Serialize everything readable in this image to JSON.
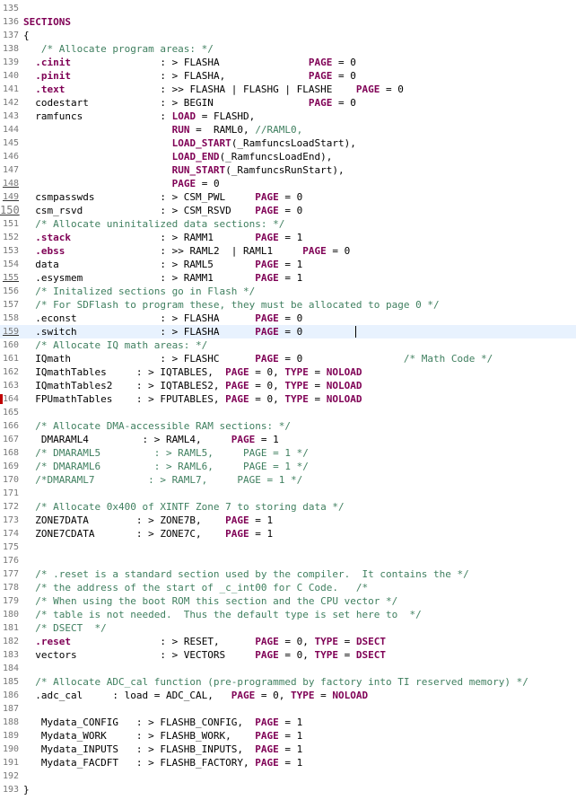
{
  "editor": {
    "current_line": 159,
    "caret_line": 159,
    "lines": [
      {
        "n": "135",
        "code": []
      },
      {
        "n": "136",
        "code": [
          {
            "t": "SECTIONS",
            "c": "kw"
          }
        ]
      },
      {
        "n": "137",
        "code": [
          {
            "t": "{",
            "c": ""
          }
        ]
      },
      {
        "n": "138",
        "code": [
          {
            "t": "   /* Allocate program areas: */",
            "c": "cm"
          }
        ]
      },
      {
        "n": "139",
        "code": [
          {
            "t": "  ",
            "c": ""
          },
          {
            "t": ".cinit",
            "c": "sec"
          },
          {
            "t": "               : > FLASHA               ",
            "c": ""
          },
          {
            "t": "PAGE",
            "c": "kw"
          },
          {
            "t": " = 0",
            "c": ""
          }
        ]
      },
      {
        "n": "140",
        "code": [
          {
            "t": "  ",
            "c": ""
          },
          {
            "t": ".pinit",
            "c": "sec"
          },
          {
            "t": "               : > FLASHA,              ",
            "c": ""
          },
          {
            "t": "PAGE",
            "c": "kw"
          },
          {
            "t": " = 0",
            "c": ""
          }
        ]
      },
      {
        "n": "141",
        "code": [
          {
            "t": "  ",
            "c": ""
          },
          {
            "t": ".text",
            "c": "sec"
          },
          {
            "t": "                : >> FLASHA | FLASHG | FLASHE    ",
            "c": ""
          },
          {
            "t": "PAGE",
            "c": "kw"
          },
          {
            "t": " = 0",
            "c": ""
          }
        ]
      },
      {
        "n": "142",
        "code": [
          {
            "t": "  codestart            : > BEGIN                ",
            "c": ""
          },
          {
            "t": "PAGE",
            "c": "kw"
          },
          {
            "t": " = 0",
            "c": ""
          }
        ]
      },
      {
        "n": "143",
        "code": [
          {
            "t": "  ramfuncs             : ",
            "c": ""
          },
          {
            "t": "LOAD",
            "c": "kw"
          },
          {
            "t": " = FLASHD,",
            "c": ""
          }
        ]
      },
      {
        "n": "144",
        "code": [
          {
            "t": "                         ",
            "c": ""
          },
          {
            "t": "RUN",
            "c": "kw"
          },
          {
            "t": " =  RAML0, ",
            "c": ""
          },
          {
            "t": "//RAML0,",
            "c": "cm"
          }
        ]
      },
      {
        "n": "145",
        "code": [
          {
            "t": "                         ",
            "c": ""
          },
          {
            "t": "LOAD_START",
            "c": "kw"
          },
          {
            "t": "(_RamfuncsLoadStart),",
            "c": ""
          }
        ]
      },
      {
        "n": "146",
        "code": [
          {
            "t": "                         ",
            "c": ""
          },
          {
            "t": "LOAD_END",
            "c": "kw"
          },
          {
            "t": "(_RamfuncsLoadEnd),",
            "c": ""
          }
        ]
      },
      {
        "n": "147",
        "code": [
          {
            "t": "                         ",
            "c": ""
          },
          {
            "t": "RUN_START",
            "c": "kw"
          },
          {
            "t": "(_RamfuncsRunStart),",
            "c": ""
          }
        ]
      },
      {
        "n": "148",
        "u": true,
        "code": [
          {
            "t": "                         ",
            "c": ""
          },
          {
            "t": "PAGE",
            "c": "kw"
          },
          {
            "t": " = 0",
            "c": ""
          }
        ]
      },
      {
        "n": "149",
        "u": true,
        "code": [
          {
            "t": "  csmpasswds           : > CSM_PWL     ",
            "c": ""
          },
          {
            "t": "PAGE",
            "c": "kw"
          },
          {
            "t": " = 0",
            "c": ""
          }
        ]
      },
      {
        "n": "150",
        "u": true,
        "big": true,
        "code": [
          {
            "t": "  csm_rsvd             : > CSM_RSVD    ",
            "c": ""
          },
          {
            "t": "PAGE",
            "c": "kw"
          },
          {
            "t": " = 0",
            "c": ""
          }
        ]
      },
      {
        "n": "151",
        "code": [
          {
            "t": "  /* Allocate uninitalized data sections: */",
            "c": "cm"
          }
        ]
      },
      {
        "n": "152",
        "code": [
          {
            "t": "  ",
            "c": ""
          },
          {
            "t": ".stack",
            "c": "sec"
          },
          {
            "t": "               : > RAMM1       ",
            "c": ""
          },
          {
            "t": "PAGE",
            "c": "kw"
          },
          {
            "t": " = 1",
            "c": ""
          }
        ]
      },
      {
        "n": "153",
        "code": [
          {
            "t": "  ",
            "c": ""
          },
          {
            "t": ".ebss",
            "c": "sec"
          },
          {
            "t": "                : >> RAML2  | RAML1     ",
            "c": ""
          },
          {
            "t": "PAGE",
            "c": "kw"
          },
          {
            "t": " = 0",
            "c": ""
          }
        ]
      },
      {
        "n": "154",
        "code": [
          {
            "t": "  data                 : > RAML5       ",
            "c": ""
          },
          {
            "t": "PAGE",
            "c": "kw"
          },
          {
            "t": " = 1",
            "c": ""
          }
        ]
      },
      {
        "n": "155",
        "u": true,
        "code": [
          {
            "t": "  .esysmem             : > RAMM1       ",
            "c": ""
          },
          {
            "t": "PAGE",
            "c": "kw"
          },
          {
            "t": " = 1",
            "c": ""
          }
        ]
      },
      {
        "n": "156",
        "code": [
          {
            "t": "  /* Initalized sections go in Flash */",
            "c": "cm"
          }
        ]
      },
      {
        "n": "157",
        "code": [
          {
            "t": "  /* For SDFlash to program these, they must be allocated to page 0 */",
            "c": "cm"
          }
        ]
      },
      {
        "n": "158",
        "code": [
          {
            "t": "  .econst              : > FLASHA      ",
            "c": ""
          },
          {
            "t": "PAGE",
            "c": "kw"
          },
          {
            "t": " = 0",
            "c": ""
          }
        ]
      },
      {
        "n": "159",
        "u": true,
        "code": [
          {
            "t": "  .switch              : > FLASHA      ",
            "c": ""
          },
          {
            "t": "PAGE",
            "c": "kw"
          },
          {
            "t": " = 0",
            "c": ""
          }
        ]
      },
      {
        "n": "160",
        "code": [
          {
            "t": "  /* Allocate IQ math areas: */",
            "c": "cm"
          }
        ]
      },
      {
        "n": "161",
        "code": [
          {
            "t": "  IQmath               : > FLASHC      ",
            "c": ""
          },
          {
            "t": "PAGE",
            "c": "kw"
          },
          {
            "t": " = 0                 ",
            "c": ""
          },
          {
            "t": "/* Math Code */",
            "c": "cm"
          }
        ]
      },
      {
        "n": "162",
        "code": [
          {
            "t": "  IQmathTables     : > IQTABLES,  ",
            "c": ""
          },
          {
            "t": "PAGE",
            "c": "kw"
          },
          {
            "t": " = 0, ",
            "c": ""
          },
          {
            "t": "TYPE",
            "c": "kw"
          },
          {
            "t": " = ",
            "c": ""
          },
          {
            "t": "NOLOAD",
            "c": "kw"
          }
        ]
      },
      {
        "n": "163",
        "code": [
          {
            "t": "  IQmathTables2    : > IQTABLES2, ",
            "c": ""
          },
          {
            "t": "PAGE",
            "c": "kw"
          },
          {
            "t": " = 0, ",
            "c": ""
          },
          {
            "t": "TYPE",
            "c": "kw"
          },
          {
            "t": " = ",
            "c": ""
          },
          {
            "t": "NOLOAD",
            "c": "kw"
          }
        ]
      },
      {
        "n": "164",
        "mark": true,
        "code": [
          {
            "t": "  FPUmathTables    : > FPUTABLES, ",
            "c": ""
          },
          {
            "t": "PAGE",
            "c": "kw"
          },
          {
            "t": " = 0, ",
            "c": ""
          },
          {
            "t": "TYPE",
            "c": "kw"
          },
          {
            "t": " = ",
            "c": ""
          },
          {
            "t": "NOLOAD",
            "c": "kw"
          }
        ]
      },
      {
        "n": "165",
        "code": []
      },
      {
        "n": "166",
        "code": [
          {
            "t": "  /* Allocate DMA-accessible RAM sections: */",
            "c": "cm"
          }
        ]
      },
      {
        "n": "167",
        "code": [
          {
            "t": "   DMARAML4         : > RAML4,     ",
            "c": ""
          },
          {
            "t": "PAGE",
            "c": "kw"
          },
          {
            "t": " = 1",
            "c": ""
          }
        ]
      },
      {
        "n": "168",
        "code": [
          {
            "t": "  /* DMARAML5         : > RAML5,     PAGE = 1 */",
            "c": "cm"
          }
        ]
      },
      {
        "n": "169",
        "code": [
          {
            "t": "  /* DMARAML6         : > RAML6,     PAGE = 1 */",
            "c": "cm"
          }
        ]
      },
      {
        "n": "170",
        "code": [
          {
            "t": "  /*DMARAML7         : > RAML7,     PAGE = 1 */",
            "c": "cm"
          }
        ]
      },
      {
        "n": "171",
        "code": []
      },
      {
        "n": "172",
        "code": [
          {
            "t": "  /* Allocate 0x400 of XINTF Zone 7 to storing data */",
            "c": "cm"
          }
        ]
      },
      {
        "n": "173",
        "code": [
          {
            "t": "  ZONE7DATA        : > ZONE7B,    ",
            "c": ""
          },
          {
            "t": "PAGE",
            "c": "kw"
          },
          {
            "t": " = 1",
            "c": ""
          }
        ]
      },
      {
        "n": "174",
        "code": [
          {
            "t": "  ZONE7CDATA       : > ZONE7C,    ",
            "c": ""
          },
          {
            "t": "PAGE",
            "c": "kw"
          },
          {
            "t": " = 1",
            "c": ""
          }
        ]
      },
      {
        "n": "175",
        "code": []
      },
      {
        "n": "176",
        "code": []
      },
      {
        "n": "177",
        "code": [
          {
            "t": "  /* .reset is a standard section used by the compiler.  It contains the */",
            "c": "cm"
          }
        ]
      },
      {
        "n": "178",
        "code": [
          {
            "t": "  /* the address of the start of _c_int00 for C Code.   /*",
            "c": "cm"
          }
        ]
      },
      {
        "n": "179",
        "code": [
          {
            "t": "  /* When using the boot ROM this section and the CPU vector */",
            "c": "cm"
          }
        ]
      },
      {
        "n": "180",
        "code": [
          {
            "t": "  /* table is not needed.  Thus the default type is set here to  */",
            "c": "cm"
          }
        ]
      },
      {
        "n": "181",
        "code": [
          {
            "t": "  /* DSECT  */",
            "c": "cm"
          }
        ]
      },
      {
        "n": "182",
        "code": [
          {
            "t": "  ",
            "c": ""
          },
          {
            "t": ".reset",
            "c": "sec"
          },
          {
            "t": "               : > RESET,      ",
            "c": ""
          },
          {
            "t": "PAGE",
            "c": "kw"
          },
          {
            "t": " = 0, ",
            "c": ""
          },
          {
            "t": "TYPE",
            "c": "kw"
          },
          {
            "t": " = ",
            "c": ""
          },
          {
            "t": "DSECT",
            "c": "kw"
          }
        ]
      },
      {
        "n": "183",
        "code": [
          {
            "t": "  vectors              : > VECTORS     ",
            "c": ""
          },
          {
            "t": "PAGE",
            "c": "kw"
          },
          {
            "t": " = 0, ",
            "c": ""
          },
          {
            "t": "TYPE",
            "c": "kw"
          },
          {
            "t": " = ",
            "c": ""
          },
          {
            "t": "DSECT",
            "c": "kw"
          }
        ]
      },
      {
        "n": "184",
        "code": []
      },
      {
        "n": "185",
        "code": [
          {
            "t": "  /* Allocate ADC_cal function (pre-programmed by factory into TI reserved memory) */",
            "c": "cm"
          }
        ]
      },
      {
        "n": "186",
        "code": [
          {
            "t": "  .adc_cal     : load = ADC_CAL,   ",
            "c": ""
          },
          {
            "t": "PAGE",
            "c": "kw"
          },
          {
            "t": " = 0, ",
            "c": ""
          },
          {
            "t": "TYPE",
            "c": "kw"
          },
          {
            "t": " = ",
            "c": ""
          },
          {
            "t": "NOLOAD",
            "c": "kw"
          }
        ]
      },
      {
        "n": "187",
        "code": []
      },
      {
        "n": "188",
        "code": [
          {
            "t": "   Mydata_CONFIG   : > FLASHB_CONFIG,  ",
            "c": ""
          },
          {
            "t": "PAGE",
            "c": "kw"
          },
          {
            "t": " = 1",
            "c": ""
          }
        ]
      },
      {
        "n": "189",
        "code": [
          {
            "t": "   Mydata_WORK     : > FLASHB_WORK,    ",
            "c": ""
          },
          {
            "t": "PAGE",
            "c": "kw"
          },
          {
            "t": " = 1",
            "c": ""
          }
        ]
      },
      {
        "n": "190",
        "code": [
          {
            "t": "   Mydata_INPUTS   : > FLASHB_INPUTS,  ",
            "c": ""
          },
          {
            "t": "PAGE",
            "c": "kw"
          },
          {
            "t": " = 1",
            "c": ""
          }
        ]
      },
      {
        "n": "191",
        "code": [
          {
            "t": "   Mydata_FACDFT   : > FLASHB_FACTORY, ",
            "c": ""
          },
          {
            "t": "PAGE",
            "c": "kw"
          },
          {
            "t": " = 1",
            "c": ""
          }
        ]
      },
      {
        "n": "192",
        "code": []
      },
      {
        "n": "193",
        "code": [
          {
            "t": "}",
            "c": ""
          }
        ]
      }
    ]
  }
}
